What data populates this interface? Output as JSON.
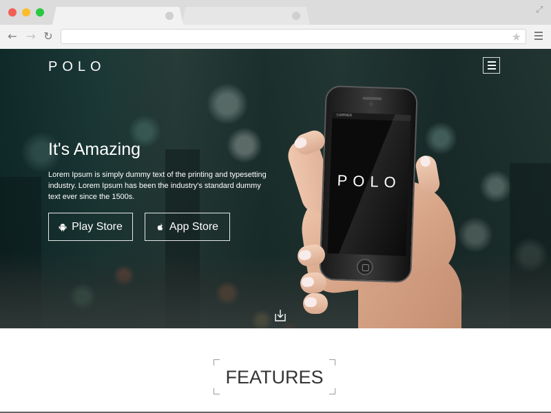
{
  "browser": {
    "address_value": "",
    "address_placeholder": "",
    "traffic_lights": [
      "#f25f57",
      "#fbbd2e",
      "#28c840"
    ]
  },
  "nav": {
    "brand": "POLO"
  },
  "hero": {
    "heading": "It's Amazing",
    "lead": "Lorem Ipsum is simply dummy text of the printing and typesetting industry. Lorem Ipsum has been the industry's standard dummy text ever since the 1500s.",
    "buttons": [
      {
        "label": "Play Store",
        "icon": "android-icon"
      },
      {
        "label": "App Store",
        "icon": "apple-icon"
      }
    ],
    "phone": {
      "carrier": "CARRIER",
      "screen_logo": "POLO"
    }
  },
  "features": {
    "title": "FEATURES"
  },
  "colors": {
    "hero_overlay": "#1d3b38",
    "text_light": "#ffffff",
    "heading_dark": "#333333"
  }
}
